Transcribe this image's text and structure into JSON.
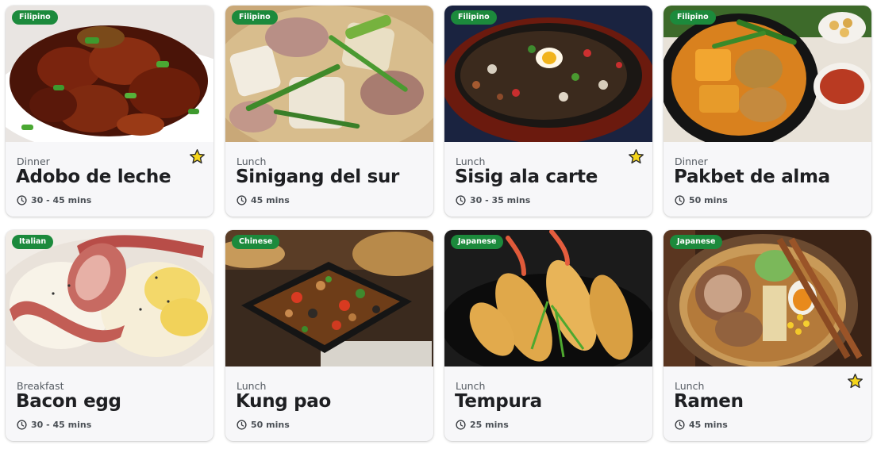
{
  "colors": {
    "badge": "#1c8a3c",
    "card_bg": "#f7f7f9",
    "star_fill": "#f5d51b",
    "star_stroke": "#2b2b2b"
  },
  "recipes": [
    {
      "cuisine": "Filipino",
      "meal": "Dinner",
      "name": "Adobo de leche",
      "time": "30 - 45 mins",
      "favorite": true,
      "image": "adobo"
    },
    {
      "cuisine": "Filipino",
      "meal": "Lunch",
      "name": "Sinigang del sur",
      "time": "45 mins",
      "favorite": false,
      "image": "sinigang"
    },
    {
      "cuisine": "Filipino",
      "meal": "Lunch",
      "name": "Sisig ala carte",
      "time": "30 - 35 mins",
      "favorite": true,
      "image": "sisig"
    },
    {
      "cuisine": "Filipino",
      "meal": "Dinner",
      "name": "Pakbet de alma",
      "time": "50 mins",
      "favorite": false,
      "image": "pakbet"
    },
    {
      "cuisine": "Italian",
      "meal": "Breakfast",
      "name": "Bacon egg",
      "time": "30 - 45 mins",
      "favorite": false,
      "image": "bacon-egg"
    },
    {
      "cuisine": "Chinese",
      "meal": "Lunch",
      "name": "Kung pao",
      "time": "50 mins",
      "favorite": false,
      "image": "kung-pao"
    },
    {
      "cuisine": "Japanese",
      "meal": "Lunch",
      "name": "Tempura",
      "time": "25 mins",
      "favorite": false,
      "image": "tempura"
    },
    {
      "cuisine": "Japanese",
      "meal": "Lunch",
      "name": "Ramen",
      "time": "45 mins",
      "favorite": true,
      "image": "ramen"
    }
  ]
}
